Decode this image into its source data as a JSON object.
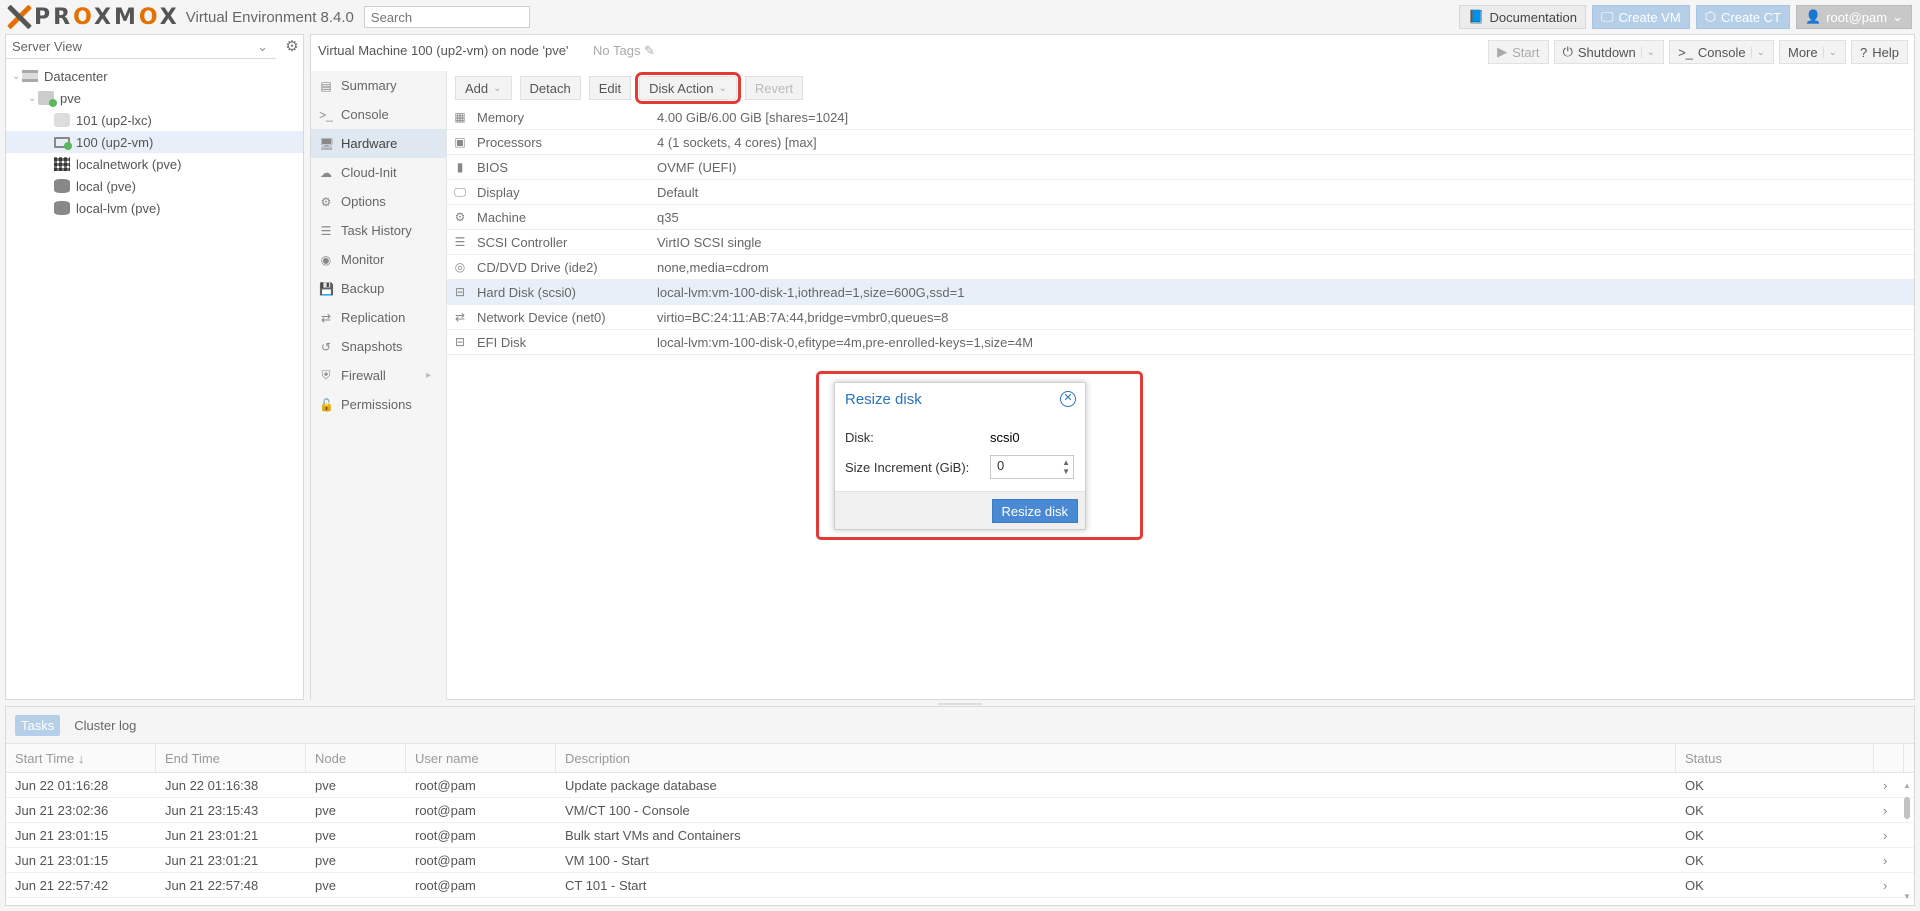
{
  "topbar": {
    "logo_text_a": "PR",
    "logo_o": "O",
    "logo_text_b": "XM",
    "logo_o2": "O",
    "logo_text_c": "X",
    "version": "Virtual Environment 8.4.0",
    "search_placeholder": "Search",
    "documentation": "Documentation",
    "create_vm": "Create VM",
    "create_ct": "Create CT",
    "user": "root@pam"
  },
  "left": {
    "view_selector": "Server View",
    "tree": [
      {
        "label": "Datacenter"
      },
      {
        "label": "pve"
      },
      {
        "label": "101 (up2-lxc)"
      },
      {
        "label": "100 (up2-vm)"
      },
      {
        "label": "localnetwork (pve)"
      },
      {
        "label": "local (pve)"
      },
      {
        "label": "local-lvm (pve)"
      }
    ]
  },
  "center": {
    "title": "Virtual Machine 100 (up2-vm) on node 'pve'",
    "tags": "No Tags",
    "actions": {
      "start": "Start",
      "shutdown": "Shutdown",
      "console": "Console",
      "more": "More",
      "help": "Help"
    },
    "nav": [
      {
        "label": "Summary"
      },
      {
        "label": "Console"
      },
      {
        "label": "Hardware"
      },
      {
        "label": "Cloud-Init"
      },
      {
        "label": "Options"
      },
      {
        "label": "Task History"
      },
      {
        "label": "Monitor"
      },
      {
        "label": "Backup"
      },
      {
        "label": "Replication"
      },
      {
        "label": "Snapshots"
      },
      {
        "label": "Firewall"
      },
      {
        "label": "Permissions"
      }
    ],
    "hw_toolbar": {
      "add": "Add",
      "detach": "Detach",
      "edit": "Edit",
      "disk_action": "Disk Action",
      "revert": "Revert"
    },
    "hardware": [
      {
        "key": "Memory",
        "value": "4.00 GiB/6.00 GiB [shares=1024]"
      },
      {
        "key": "Processors",
        "value": "4 (1 sockets, 4 cores) [max]"
      },
      {
        "key": "BIOS",
        "value": "OVMF (UEFI)"
      },
      {
        "key": "Display",
        "value": "Default"
      },
      {
        "key": "Machine",
        "value": "q35"
      },
      {
        "key": "SCSI Controller",
        "value": "VirtIO SCSI single"
      },
      {
        "key": "CD/DVD Drive (ide2)",
        "value": "none,media=cdrom"
      },
      {
        "key": "Hard Disk (scsi0)",
        "value": "local-lvm:vm-100-disk-1,iothread=1,size=600G,ssd=1"
      },
      {
        "key": "Network Device (net0)",
        "value": "virtio=BC:24:11:AB:7A:44,bridge=vmbr0,queues=8"
      },
      {
        "key": "EFI Disk",
        "value": "local-lvm:vm-100-disk-0,efitype=4m,pre-enrolled-keys=1,size=4M"
      }
    ]
  },
  "dialog": {
    "title": "Resize disk",
    "disk_label": "Disk:",
    "disk_value": "scsi0",
    "size_label": "Size Increment (GiB):",
    "size_value": "0",
    "submit": "Resize disk"
  },
  "bottom": {
    "tabs": [
      "Tasks",
      "Cluster log"
    ],
    "columns": [
      "Start Time ↓",
      "End Time",
      "Node",
      "User name",
      "Description",
      "Status"
    ],
    "rows": [
      {
        "start": "Jun 22 01:16:28",
        "end": "Jun 22 01:16:38",
        "node": "pve",
        "user": "root@pam",
        "desc": "Update package database",
        "status": "OK"
      },
      {
        "start": "Jun 21 23:02:36",
        "end": "Jun 21 23:15:43",
        "node": "pve",
        "user": "root@pam",
        "desc": "VM/CT 100 - Console",
        "status": "OK"
      },
      {
        "start": "Jun 21 23:01:15",
        "end": "Jun 21 23:01:21",
        "node": "pve",
        "user": "root@pam",
        "desc": "Bulk start VMs and Containers",
        "status": "OK"
      },
      {
        "start": "Jun 21 23:01:15",
        "end": "Jun 21 23:01:21",
        "node": "pve",
        "user": "root@pam",
        "desc": "VM 100 - Start",
        "status": "OK"
      },
      {
        "start": "Jun 21 22:57:42",
        "end": "Jun 21 22:57:48",
        "node": "pve",
        "user": "root@pam",
        "desc": "CT 101 - Start",
        "status": "OK"
      }
    ]
  }
}
